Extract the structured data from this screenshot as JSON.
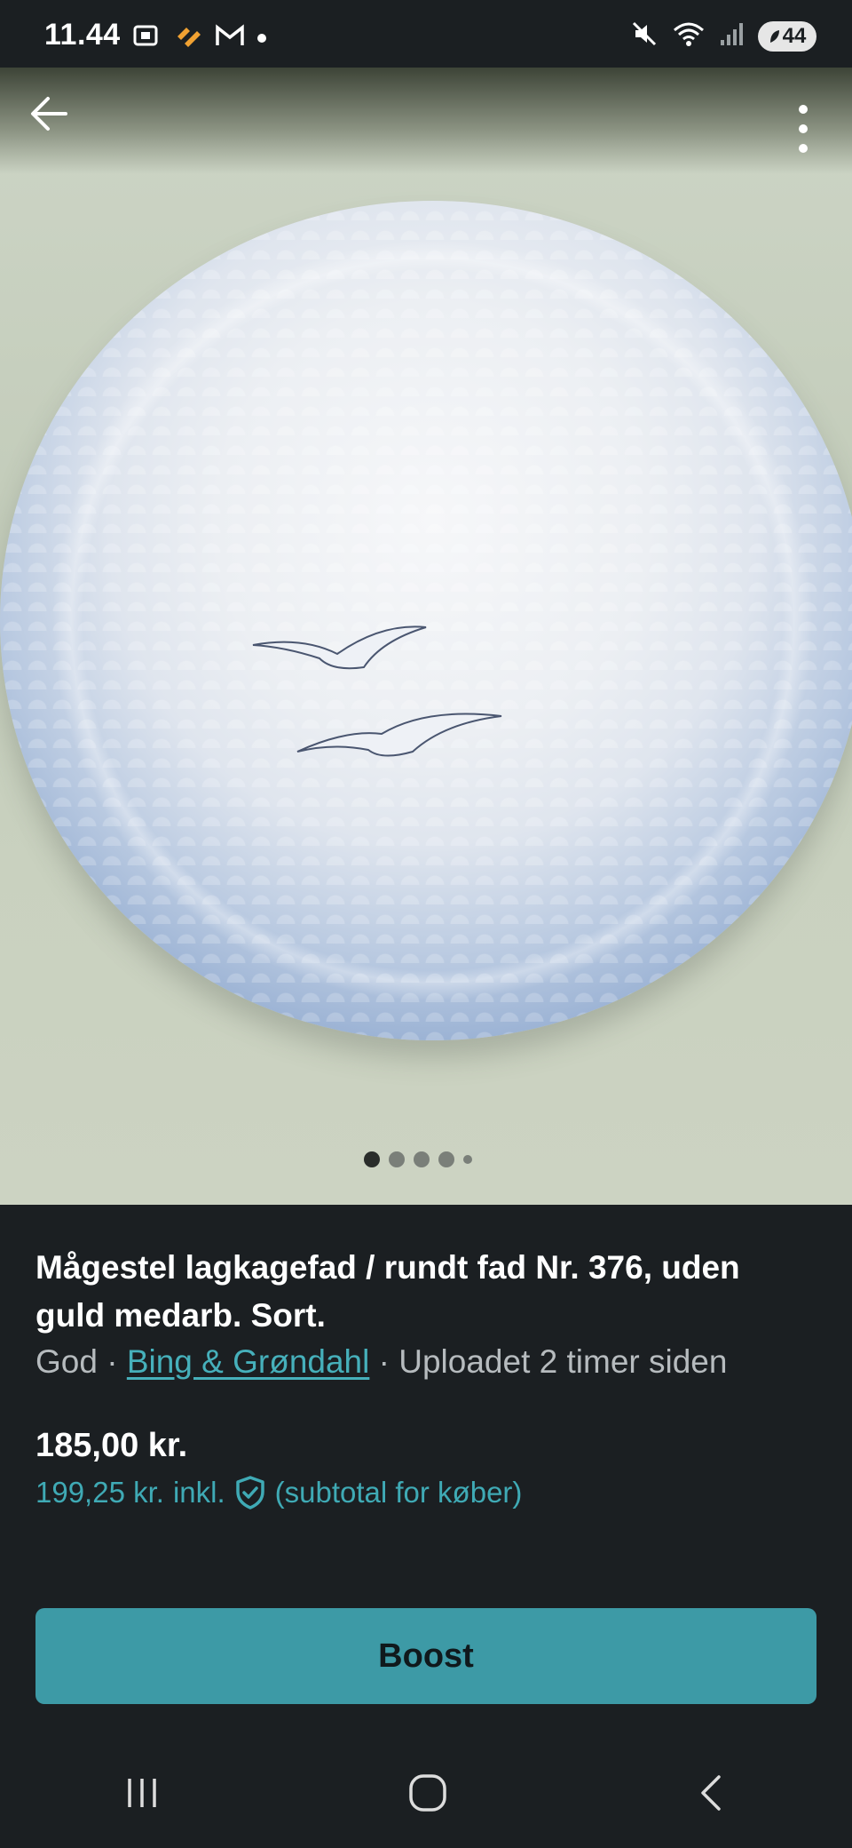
{
  "status_bar": {
    "time": "11.44",
    "battery_level": "44",
    "icons_left": [
      "screenshot-icon",
      "heart-app-icon",
      "gmail-icon",
      "notification-dot-icon"
    ],
    "icons_right": [
      "mute-icon",
      "wifi-icon",
      "signal-icon",
      "battery-icon"
    ]
  },
  "toolbar": {
    "back_icon": "arrow-left-icon",
    "menu_icon": "more-vertical-icon"
  },
  "gallery": {
    "page_count": 5,
    "active_index": 0
  },
  "listing": {
    "title": "Mågestel lagkagefad / rundt fad Nr. 376, uden guld medarb. Sort.",
    "condition": "God",
    "separator": " · ",
    "brand": "Bing & Grøndahl",
    "uploaded": "Uploadet 2 timer siden",
    "price": "185,00 kr.",
    "subtotal_amount": "199,25 kr.",
    "subtotal_incl": "inkl.",
    "subtotal_note": "(subtotal for køber)"
  },
  "actions": {
    "boost_label": "Boost"
  },
  "colors": {
    "background": "#1b1f22",
    "accent": "#3d9aa6",
    "link": "#46b0bb"
  }
}
